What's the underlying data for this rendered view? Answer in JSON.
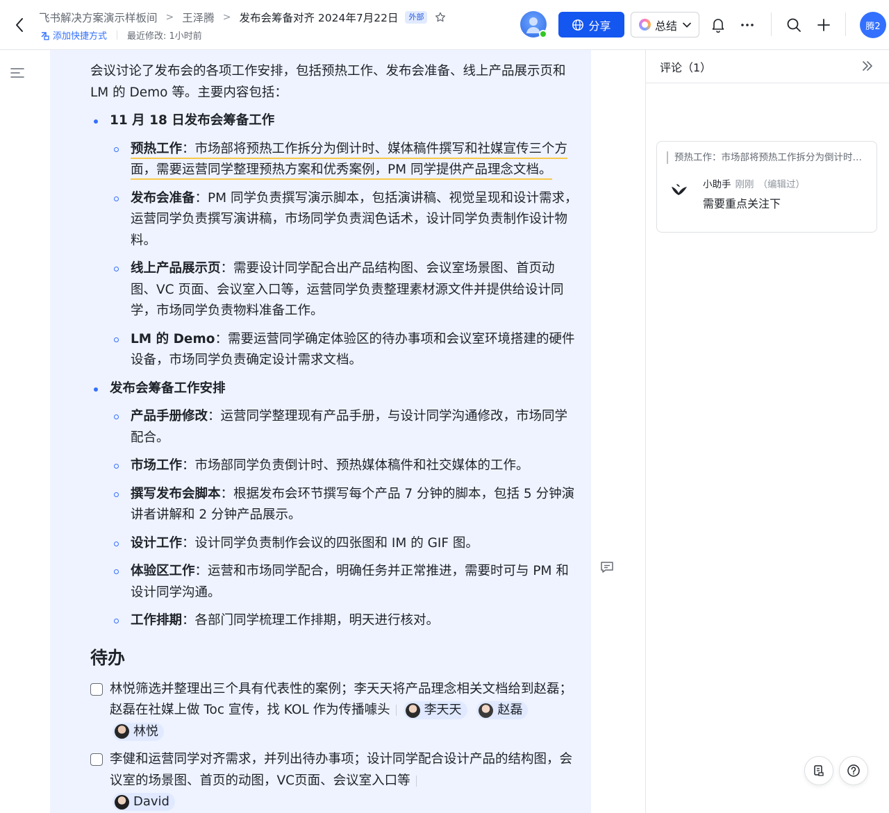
{
  "header": {
    "breadcrumbs": [
      "飞书解决方案演示样板间",
      "王泽腾",
      "发布会筹备对齐 2024年7月22日"
    ],
    "external_tag": "外部",
    "add_shortcut": "添加快捷方式",
    "last_modified": "最近修改: 1小时前",
    "share_label": "分享",
    "summary_label": "总结",
    "me_avatar": "腾2"
  },
  "doc": {
    "intro": "会议讨论了发布会的各项工作安排，包括预热工作、发布会准备、线上产品展示页和 LM 的 Demo 等。主要内容包括：",
    "sections": [
      {
        "title": "11 月 18 日发布会筹备工作",
        "items": [
          {
            "label": "预热工作",
            "text": "：市场部将预热工作拆分为倒计时、媒体稿件撰写和社媒宣传三个方面，需要运营同学整理预热方案和优秀案例，PM 同学提供产品理念文档。"
          },
          {
            "label": "发布会准备",
            "text": "：PM 同学负责撰写演示脚本，包括演讲稿、视觉呈现和设计需求，运营同学负责撰写演讲稿，市场同学负责润色话术，设计同学负责制作设计物料。"
          },
          {
            "label": "线上产品展示页",
            "text": "：需要设计同学配合出产品结构图、会议室场景图、首页动图、VC 页面、会议室入口等，运营同学负责整理素材源文件并提供给设计同学，市场同学负责物料准备工作。"
          },
          {
            "label": "LM 的 Demo",
            "text": "：需要运营同学确定体验区的待办事项和会议室环境搭建的硬件设备，市场同学负责确定设计需求文档。"
          }
        ]
      },
      {
        "title": "发布会筹备工作安排",
        "items": [
          {
            "label": "产品手册修改",
            "text": "：运营同学整理现有产品手册，与设计同学沟通修改，市场同学配合。"
          },
          {
            "label": "市场工作",
            "text": "：市场部同学负责倒计时、预热媒体稿件和社交媒体的工作。"
          },
          {
            "label": "撰写发布会脚本",
            "text": "：根据发布会环节撰写每个产品 7 分钟的脚本，包括 5 分钟演讲者讲解和 2 分钟产品展示。"
          },
          {
            "label": "设计工作",
            "text": "：设计同学负责制作会议的四张图和 IM 的 GIF 图。"
          },
          {
            "label": "体验区工作",
            "text": "：运营和市场同学配合，明确任务并正常推进，需要时可与 PM 和设计同学沟通。"
          },
          {
            "label": "工作排期",
            "text": "：各部门同学梳理工作排期，明天进行核对。"
          }
        ]
      }
    ],
    "todo_heading": "待办",
    "todos": [
      {
        "text": "林悦筛选并整理出三个具有代表性的案例；李天天将产品理念相关文档给到赵磊；赵磊在社媒上做 Toc 宣传，找 KOL 作为传播噱头",
        "assignees": [
          "李天天",
          "赵磊",
          "林悦"
        ]
      },
      {
        "text": "李健和运营同学对齐需求，并列出待办事项；设计同学配合设计产品的结构图，会议室的场景图、首页的动图，VC页面、会议室入口等",
        "assignees": [
          "David"
        ]
      }
    ]
  },
  "comments": {
    "header": "评论（1）",
    "items": [
      {
        "quote": "预热工作：市场部将预热工作拆分为倒计时、媒体稿件撰写和社媒宣传三个方面，需要运营同学整理预热方案和优秀案例，PM 同学提供产品理念文档。",
        "author": "小助手",
        "time": "刚刚",
        "edited": "（编辑过）",
        "body": "需要重点关注下"
      }
    ]
  }
}
